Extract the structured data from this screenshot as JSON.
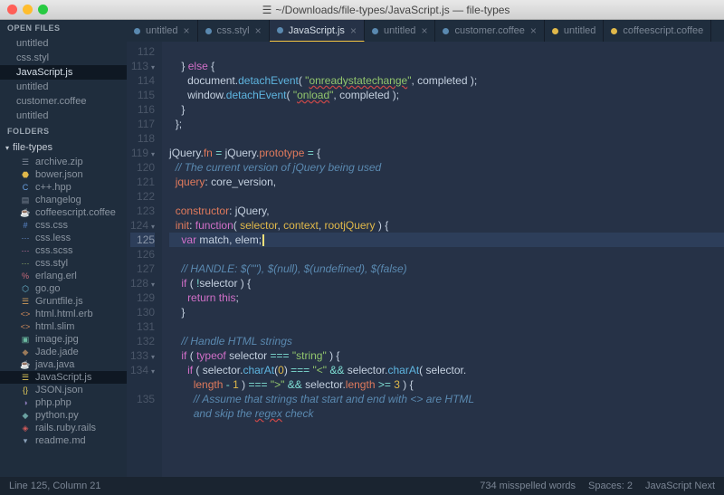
{
  "window": {
    "title": "~/Downloads/file-types/JavaScript.js — file-types"
  },
  "sidebar": {
    "open_label": "OPEN FILES",
    "open": [
      {
        "name": "untitled"
      },
      {
        "name": "css.styl"
      },
      {
        "name": "JavaScript.js",
        "active": true
      },
      {
        "name": "untitled"
      },
      {
        "name": "customer.coffee"
      },
      {
        "name": "untitled"
      }
    ],
    "folders_label": "FOLDERS",
    "folder": "file-types",
    "files": [
      {
        "name": "archive.zip",
        "ic": "☰",
        "c": "#7a8594"
      },
      {
        "name": "bower.json",
        "ic": "⬣",
        "c": "#e0b84a"
      },
      {
        "name": "c++.hpp",
        "ic": "C",
        "c": "#6aa0e0"
      },
      {
        "name": "changelog",
        "ic": "▤",
        "c": "#7a8594"
      },
      {
        "name": "coffeescript.coffee",
        "ic": "☕",
        "c": "#b88a4a"
      },
      {
        "name": "css.css",
        "ic": "#",
        "c": "#5a89d0"
      },
      {
        "name": "css.less",
        "ic": "⋯",
        "c": "#6a90d0"
      },
      {
        "name": "css.scss",
        "ic": "⋯",
        "c": "#d07aa5"
      },
      {
        "name": "css.styl",
        "ic": "⋯",
        "c": "#9ab86a"
      },
      {
        "name": "erlang.erl",
        "ic": "%",
        "c": "#c86a7a"
      },
      {
        "name": "go.go",
        "ic": "⬡",
        "c": "#6ab8d0"
      },
      {
        "name": "Gruntfile.js",
        "ic": "☰",
        "c": "#d09a5a"
      },
      {
        "name": "html.html.erb",
        "ic": "<>",
        "c": "#d08a5a"
      },
      {
        "name": "html.slim",
        "ic": "<>",
        "c": "#d08a5a"
      },
      {
        "name": "image.jpg",
        "ic": "▣",
        "c": "#6ab8a0"
      },
      {
        "name": "Jade.jade",
        "ic": "◆",
        "c": "#9a7a5a"
      },
      {
        "name": "java.java",
        "ic": "☕",
        "c": "#d07a5a"
      },
      {
        "name": "JavaScript.js",
        "ic": "☰",
        "c": "#e0c85a",
        "active": true
      },
      {
        "name": "JSON.json",
        "ic": "{}",
        "c": "#e0c85a"
      },
      {
        "name": "php.php",
        "ic": "◑",
        "c": "#8a7ab8"
      },
      {
        "name": "python.py",
        "ic": "◆",
        "c": "#6aa0a0"
      },
      {
        "name": "rails.ruby.rails",
        "ic": "◈",
        "c": "#d05a5a"
      },
      {
        "name": "readme.md",
        "ic": "▾",
        "c": "#8aa0b8"
      }
    ]
  },
  "tabs": [
    {
      "label": "untitled",
      "dot": "b",
      "close": true
    },
    {
      "label": "css.styl",
      "dot": "b",
      "close": true
    },
    {
      "label": "JavaScript.js",
      "dot": "b",
      "active": true,
      "close": true
    },
    {
      "label": "untitled",
      "dot": "b",
      "close": true
    },
    {
      "label": "customer.coffee",
      "dot": "b",
      "close": true
    },
    {
      "label": "untitled",
      "dot": "y"
    },
    {
      "label": "coffeescript.coffee",
      "dot": "y"
    }
  ],
  "code": {
    "start": 112,
    "hl": 125,
    "folds": [
      113,
      119,
      124,
      128,
      133,
      134
    ],
    "lines": [
      "",
      "    <span class='pl'>}</span> <span class='kw'>else</span> <span class='pl'>{</span>",
      "      <span class='pl'>document.</span><span class='fn'>detachEvent</span><span class='pl'>( </span><span class='st'>\"<span class='err'>onreadystatechange</span>\"</span><span class='pl'>, completed );</span>",
      "      <span class='pl'>window.</span><span class='fn'>detachEvent</span><span class='pl'>( </span><span class='st'>\"<span class='err'>onload</span>\"</span><span class='pl'>, completed );</span>",
      "    <span class='pl'>}</span>",
      "  <span class='pl'>};</span>",
      "",
      "<span class='pl'>jQuery.</span><span class='pr'>fn</span> <span class='op'>=</span> <span class='pl'>jQuery.</span><span class='pr'>prototype</span> <span class='op'>=</span> <span class='pl'>{</span>",
      "  <span class='cm'>// The current version of jQuery being used</span>",
      "  <span class='pr'>jquery</span><span class='pl'>: core_version,</span>",
      "",
      "  <span class='pr'>constructor</span><span class='pl'>: jQuery,</span>",
      "  <span class='pr'>init</span><span class='pl'>: </span><span class='kw'>function</span><span class='pl'>( </span><span class='nm'>selector</span><span class='pl'>, </span><span class='nm'>context</span><span class='pl'>, </span><span class='nm'>rootjQuery</span><span class='pl'> ) {</span>",
      "    <span class='kw'>var</span> <span class='pl'>match, elem;</span><span class='cursor'></span>",
      "",
      "    <span class='cm'>// HANDLE: $(\"\"), $(null), $(undefined), $(false)</span>",
      "    <span class='kw'>if</span> <span class='pl'>( </span><span class='op'>!</span><span class='pl'>selector ) {</span>",
      "      <span class='kw'>return</span> <span class='kw'>this</span><span class='pl'>;</span>",
      "    <span class='pl'>}</span>",
      "",
      "    <span class='cm'>// Handle HTML strings</span>",
      "    <span class='kw'>if</span> <span class='pl'>( </span><span class='kw'>typeof</span> <span class='pl'>selector </span><span class='op'>===</span> <span class='st'>\"string\"</span> <span class='pl'>) {</span>",
      "      <span class='kw'>if</span> <span class='pl'>( selector.</span><span class='fn'>charAt</span><span class='pl'>(</span><span class='nm'>0</span><span class='pl'>) </span><span class='op'>===</span> <span class='st'>\"&lt;\"</span> <span class='op'>&amp;&amp;</span> <span class='pl'>selector.</span><span class='fn'>charAt</span><span class='pl'>( selector.</span>",
      "        <span class='pr'>length</span> <span class='op'>-</span> <span class='nm'>1</span> <span class='pl'>) </span><span class='op'>===</span> <span class='st'>\"&gt;\"</span> <span class='op'>&amp;&amp;</span> <span class='pl'>selector.</span><span class='pr'>length</span> <span class='op'>&gt;=</span> <span class='nm'>3</span> <span class='pl'>) {</span>",
      "        <span class='cm'>// Assume that strings that start and end with &lt;&gt; are HTML</span>",
      "        <span class='cm'>and skip the <span class='err'>regex</span> check</span>"
    ]
  },
  "status": {
    "pos": "Line 125, Column 21",
    "spell": "734 misspelled words",
    "spaces": "Spaces: 2",
    "lang": "JavaScript Next"
  }
}
